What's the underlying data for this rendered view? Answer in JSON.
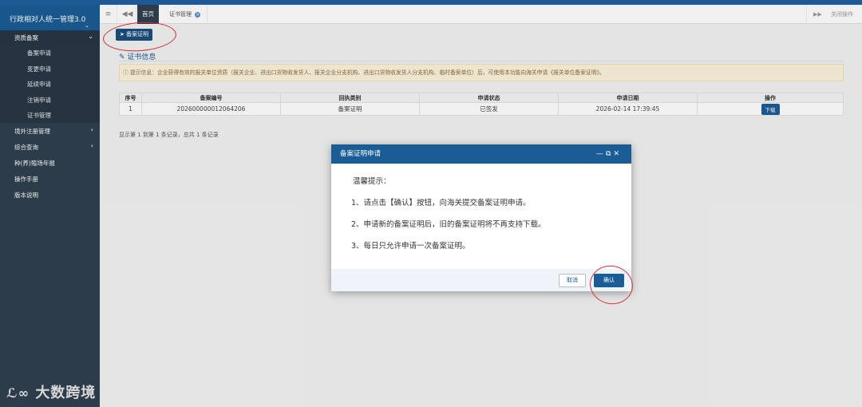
{
  "app": {
    "title": "行政相对人统一管理3.0"
  },
  "sidebar": {
    "group_label": "资质备案",
    "sub_items": [
      "备案申请",
      "变更申请",
      "延续申请",
      "注销申请",
      "证书管理"
    ],
    "items": [
      {
        "label": "境外注册管理",
        "has_arrow": true
      },
      {
        "label": "综合查询",
        "has_arrow": true
      },
      {
        "label": "种(养)殖场年报",
        "has_arrow": false
      },
      {
        "label": "操作手册",
        "has_arrow": false
      },
      {
        "label": "版本说明",
        "has_arrow": false
      }
    ]
  },
  "tabbar": {
    "home_label": "首页",
    "active_tab_label": "证书管理",
    "close_ops_label": "关闭操作"
  },
  "content": {
    "filing_button_label": "备案证明",
    "section_title": "证书信息",
    "notice_text": "提示信息：企业获得有效的报关单位资质（报关企业、进出口货物收发货人、报关企业分支机构、进出口货物收发货人分支机构、临时备案单位）后，可使用本功能向海关申请《报关单位备案证明》。",
    "table": {
      "headers": [
        "序号",
        "备案编号",
        "回执类别",
        "申请状态",
        "申请日期",
        "操作"
      ],
      "rows": [
        {
          "index": "1",
          "number": "202600000012064206",
          "type": "备案证明",
          "status": "已签发",
          "date": "2026-02-14 17:39:45",
          "action": "下载"
        }
      ]
    },
    "pager_text": "显示第 1 到第 1 条记录，总共 1 条记录"
  },
  "modal": {
    "title": "备案证明申请",
    "heading": "温馨提示：",
    "lines": [
      "1、请点击【确认】按钮，向海关提交备案证明申请。",
      "2、申请新的备案证明后，旧的备案证明将不再支持下载。",
      "3、每日只允许申请一次备案证明。"
    ],
    "cancel_label": "取消",
    "confirm_label": "确认"
  },
  "watermark": {
    "text": "大数跨境"
  },
  "colors": {
    "primary": "#1a5c95",
    "sidebar": "#2f4050",
    "notice_bg": "#fcf4dd",
    "annotation": "#e03030"
  }
}
